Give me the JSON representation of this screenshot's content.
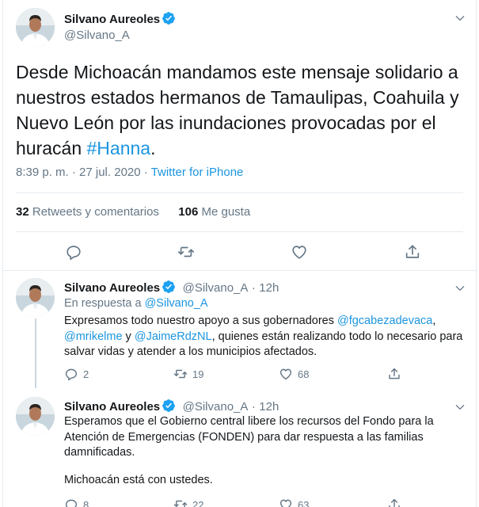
{
  "tweet": {
    "display_name": "Silvano Aureoles",
    "handle": "@Silvano_A",
    "text_prefix": "Desde Michoacán mandamos este mensaje solidario a nuestros estados hermanos de Tamaulipas, Coahuila y Nuevo León por las inundaciones provocadas por el huracán ",
    "hashtag": "#Hanna",
    "text_suffix": ".",
    "time": "8:39 p. m. · 27 jul. 2020 · ",
    "source": "Twitter for iPhone",
    "retweets_count": "32",
    "retweets_label": "Retweets y comentarios",
    "likes_count": "106",
    "likes_label": "Me gusta"
  },
  "replies": [
    {
      "display_name": "Silvano Aureoles",
      "handle": "@Silvano_A",
      "sep": "·",
      "time": "12h",
      "in_reply_label": "En respuesta a ",
      "in_reply_handle": "@Silvano_A",
      "segments": [
        {
          "text": "Expresamos todo nuestro apoyo a sus gobernadores ",
          "link": false
        },
        {
          "text": "@fgcabezadevaca",
          "link": true
        },
        {
          "text": ", ",
          "link": false
        },
        {
          "text": "@mrikelme",
          "link": true
        },
        {
          "text": " y ",
          "link": false
        },
        {
          "text": "@JaimeRdzNL",
          "link": true
        },
        {
          "text": ", quienes están realizando todo lo necesario para salvar vidas y atender a los municipios afectados.",
          "link": false
        }
      ],
      "replies_count": "2",
      "retweets_count": "19",
      "likes_count": "68"
    },
    {
      "display_name": "Silvano Aureoles",
      "handle": "@Silvano_A",
      "sep": "·",
      "time": "12h",
      "body_1": "Esperamos que el Gobierno central libere los recursos del Fondo para la Atención de Emergencias (FONDEN) para dar respuesta a las familias damnificadas.",
      "body_2": "Michoacán está con ustedes.",
      "replies_count": "8",
      "retweets_count": "22",
      "likes_count": "63"
    }
  ],
  "icons": {
    "verified": "verified-badge-icon",
    "chevron": "chevron-down-icon",
    "reply": "reply-icon",
    "retweet": "retweet-icon",
    "like": "heart-icon",
    "share": "share-icon"
  },
  "colors": {
    "accent": "#1b95e0",
    "verified": "#1da1f2",
    "muted": "#657786",
    "text": "#14171a",
    "divider": "#e6ecf0"
  }
}
